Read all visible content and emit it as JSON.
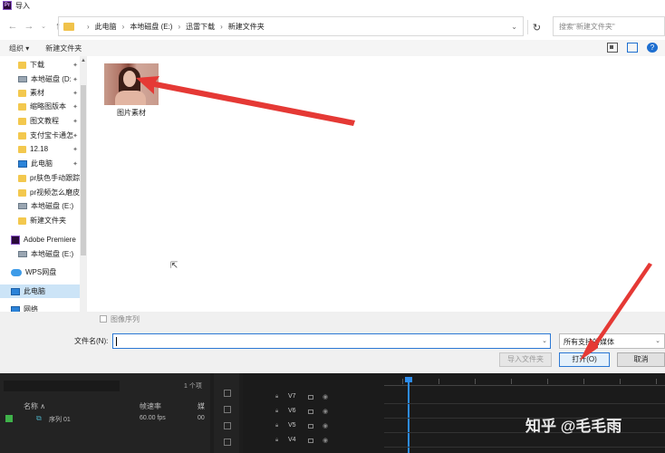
{
  "window": {
    "title": "导入",
    "app_badge": "Pr"
  },
  "nav": {
    "breadcrumb": [
      "此电脑",
      "本地磁盘 (E:)",
      "迅雷下载",
      "新建文件夹"
    ],
    "search_placeholder": "搜索\"新建文件夹\""
  },
  "toolbar": {
    "organize": "组织 ▾",
    "new_folder": "新建文件夹"
  },
  "sidebar": {
    "items": [
      {
        "label": "下载",
        "icon": "folder-icon",
        "pinned": true
      },
      {
        "label": "本地磁盘 (D:",
        "icon": "drive-icon",
        "pinned": true
      },
      {
        "label": "素材",
        "icon": "folder-icon",
        "pinned": true
      },
      {
        "label": "缩略图版本",
        "icon": "folder-icon",
        "pinned": true
      },
      {
        "label": "图文教程",
        "icon": "folder-icon",
        "pinned": true
      },
      {
        "label": "支付宝卡通怎",
        "icon": "folder-icon",
        "pinned": true
      },
      {
        "label": "12.18",
        "icon": "folder-icon",
        "pinned": true
      },
      {
        "label": "此电脑",
        "icon": "computer-icon",
        "pinned": true
      },
      {
        "label": "pr肤色手动跟踪",
        "icon": "folder-icon",
        "pinned": false
      },
      {
        "label": "pr视频怎么磨皮",
        "icon": "folder-icon",
        "pinned": false
      },
      {
        "label": "本地磁盘 (E:)",
        "icon": "drive-icon",
        "pinned": false
      },
      {
        "label": "新建文件夹",
        "icon": "folder-icon",
        "pinned": false
      },
      {
        "label": "Adobe Premiere",
        "icon": "premiere-icon",
        "pinned": false
      },
      {
        "label": "本地磁盘 (E:)",
        "icon": "drive-icon",
        "pinned": false
      },
      {
        "label": "WPS网盘",
        "icon": "cloud-icon",
        "pinned": false
      },
      {
        "label": "此电脑",
        "icon": "computer-icon",
        "pinned": false
      },
      {
        "label": "网络",
        "icon": "network-icon",
        "pinned": false
      }
    ]
  },
  "files": [
    {
      "name": "图片素材",
      "type": "image"
    }
  ],
  "image_sequence_label": "图像序列",
  "footer": {
    "filename_label": "文件名(N):",
    "filename_value": "",
    "filetype_value": "所有支持的媒体",
    "import_folder": "导入文件夹",
    "open": "打开(O)",
    "cancel": "取消"
  },
  "premiere": {
    "item_count": "1 个项",
    "columns": [
      "名称 ∧",
      "帧速率",
      "媒"
    ],
    "sequence": {
      "name": "序列 01",
      "fps": "60.00 fps",
      "media": "00"
    },
    "tracks": [
      "V7",
      "V6",
      "V5",
      "V4"
    ]
  },
  "watermark": "知乎 @毛毛雨",
  "colors": {
    "accent": "#2b78d4",
    "annotation_arrow": "#e53935",
    "folder": "#f3c84e"
  }
}
